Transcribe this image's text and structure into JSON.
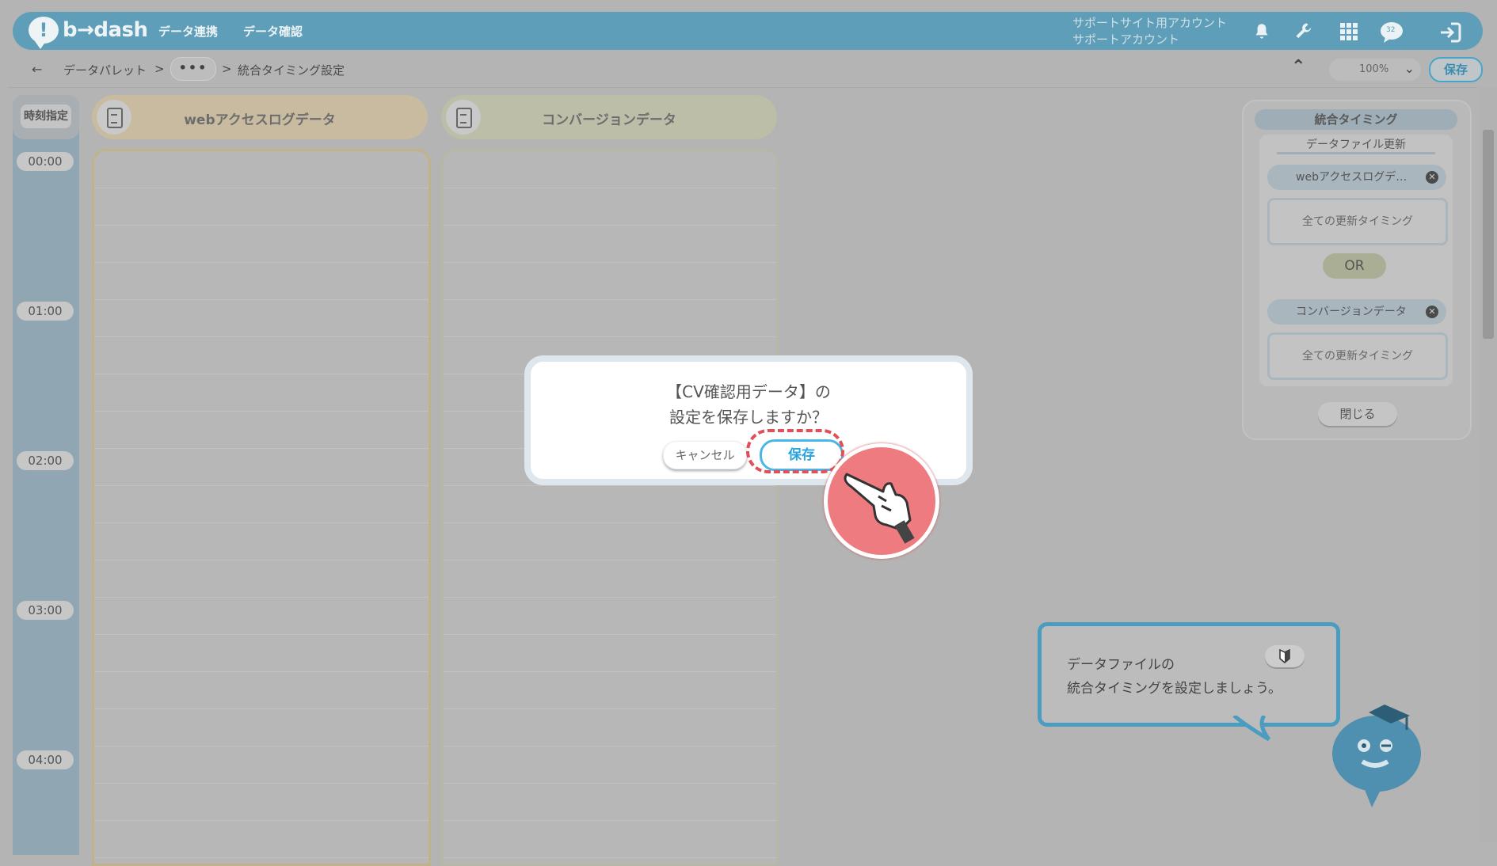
{
  "app": {
    "logo_text": "b→dash",
    "logo_mark": "!"
  },
  "header": {
    "nav": [
      "データ連携",
      "データ確認"
    ],
    "account_line1": "サポートサイト用アカウント",
    "account_line2": "サポートアカウント",
    "icons": [
      "bell-icon",
      "wrench-icon",
      "grid-icon",
      "chat-icon",
      "logout-icon"
    ],
    "chat_badge": "32"
  },
  "breadcrumb": {
    "back": "←",
    "root": "データパレット",
    "sep1": ">",
    "more": "•••",
    "sep2": ">",
    "current": "統合タイミング設定"
  },
  "toolbar": {
    "collapse": "⌃",
    "zoom": "100%",
    "zoom_caret": "⌄",
    "save_label": "保存"
  },
  "time_header": "時刻指定",
  "time_labels": [
    "00:00",
    "01:00",
    "02:00",
    "03:00",
    "04:00"
  ],
  "columns": [
    {
      "label": "webアクセスログデータ"
    },
    {
      "label": "コンバージョンデータ"
    }
  ],
  "right_panel": {
    "title": "統合タイミング",
    "subtitle": "データファイル更新",
    "items": [
      {
        "label": "webアクセスログデ…",
        "timing": "全ての更新タイミング"
      },
      {
        "label": "コンバージョンデータ",
        "timing": "全ての更新タイミング"
      }
    ],
    "or_label": "OR",
    "close_label": "閉じる"
  },
  "tip": {
    "line1": "データファイルの",
    "line2": "統合タイミングを設定しましょう。",
    "button_icon": "beginner-mark-icon"
  },
  "modal": {
    "line1": "【CV確認用データ】の",
    "line2": "設定を保存しますか？",
    "cancel_label": "キャンセル",
    "save_label": "保存"
  },
  "colors": {
    "header": "#5f9eb8",
    "accent": "#48b6e6",
    "highlight": "#e0505a",
    "pointer_circle": "#ee7b7f",
    "column1_head": "#c8bb9f",
    "column2_head": "#bcbea7"
  }
}
